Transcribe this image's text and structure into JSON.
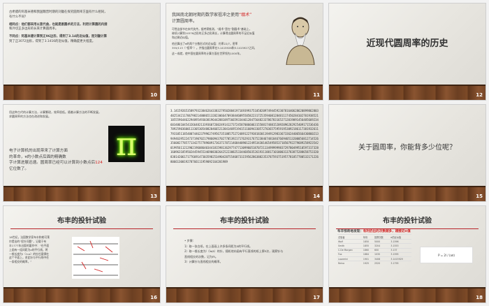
{
  "slides": [
    {
      "number": "10",
      "lines": [
        "古希腊的阿基米德和我国魏晋时期的刘徽在探究圆周率方面有什么相同，",
        "有什么不同？",
        "相同点：他们都采用以直代曲，也就是割圆术的方法，利用计算圆的内接",
        "和外切正多边形的长来计算圆周率。",
        "不同点：阿基米德计算到正96边形，得到了3.14的近似值，而刘徽计算",
        "到了正3072边形，得到了3.1416的近似值，精确度更大程度。"
      ]
    },
    {
      "number": "11",
      "heading_pre": "我国南北朝时期的数学家祖冲之使用",
      "heading_red": "“缀术”",
      "heading_post": "计算圆周率。",
      "lines": [
        "可惜这部书在宋代失传。据考察推测，“缀术”是在“割圆术”基础上，",
        "继续计算到24576边形的正多边形周长，计算得出圆周率的不足近似值",
        "和过剩近似值。",
        "他还算出了π的两个分数形式的近似值：约率22/7，密率",
        "355/113（“祖率”）。并指出圆周率在3.1415926和3.1415927之间，",
        "这一成就，使中国在圆周率的计算方面在世界领先1000年。"
      ]
    },
    {
      "number": "12",
      "title": "近现代圆周率的历史"
    },
    {
      "number": "13",
      "top_lines": [
        "用这种古代的计算方法，计算繁琐，效率很低。随着计算方法的不断发展，",
        "求圆周率的方法也在改进和发展。"
      ],
      "bottom_lines": [
        "电子计算机的出现带来了计算方面",
        "的革命，π的小数点后面的精确数",
        "字计算进展迅速。圆周率已经可以计算到小数点后",
        "亿位数了。"
      ],
      "red_fragment": "124"
    },
    {
      "number": "14",
      "digits": "3.1415926535897932384626433832795028841971693993751058209749445923078164062862089986280348253421170679821480865132823066470938446095505822317253594081284811174502841027019385211055596446229489549303819644288109756659334461284756482337867831652712019091456485669234603486104543266482133936072602491412737245870066063155881748815209209628292540917153643678925903600113305305488204665213841469519415116094330572703657595919530921861173819326117931051185480744623799627495673518857527248912279381830119491298336733624406566430860213949463952247371907021798609437027705392171762931767523846748184676694051320005681271452635608277857713427577896091736371787214684409012249534301465495853710507922796892589235420199561121290219608640344181598136297747713099605187072113499999983729780499510597317328160963185950244594553469083026425223082533446850352619311881710100031378387528865875332083814206171776691473035982534904287554687311595628638823537875937519577818577805321712268066130019278766111959092164201989"
    },
    {
      "number": "15",
      "question": "关于圆周率，你能背多少位呢？"
    },
    {
      "number": "16",
      "title": "布丰的投针试验",
      "lines": [
        "18世纪，法国数学家布丰和勒可莱",
        "尔提出的“投针问题”，记载于布",
        "丰1777年出版的著作中：“在平面",
        "上画有一组间距为a的平行线，将",
        "一根长度为l（l<a）的针任意掷在",
        "这个平面上，求此针与平行线中任",
        "一条相交的概率。”"
      ]
    },
    {
      "number": "17",
      "title": "布丰的投针试验",
      "steps": [
        "• 步骤：",
        "1）取一张白纸，在上面画上许多条间距为a的平行线。",
        "2）取一根长度为l（l≤a）的针，随机地向画有平行直线的纸上掷n次，观察针与",
        "直线相交的次数，记为m。",
        "3）计算针与直线相交的概率。"
      ]
    },
    {
      "number": "18",
      "title": "布丰的投针试验",
      "subtitle_pre": "布丰惊奇地发现：",
      "subtitle_red": "有利扔出的次数越多，越接近π值",
      "table": [
        [
          "试验者",
          "年份",
          "投掷次数",
          "π的近似值"
        ],
        [
          "Wolf",
          "1850",
          "5000",
          "3.1596"
        ],
        [
          "Smith",
          "1855",
          "3204",
          "3.1553"
        ],
        [
          "C.De Morgan",
          "1860",
          "600",
          "3.137"
        ],
        [
          "Fox",
          "1884",
          "1030",
          "3.1595"
        ],
        [
          "Lazzerini",
          "1901",
          "3408",
          "3.1415929"
        ],
        [
          "Reina",
          "1925",
          "2520",
          "3.1795"
        ]
      ],
      "formula": "P = 2l / (aπ)"
    }
  ]
}
